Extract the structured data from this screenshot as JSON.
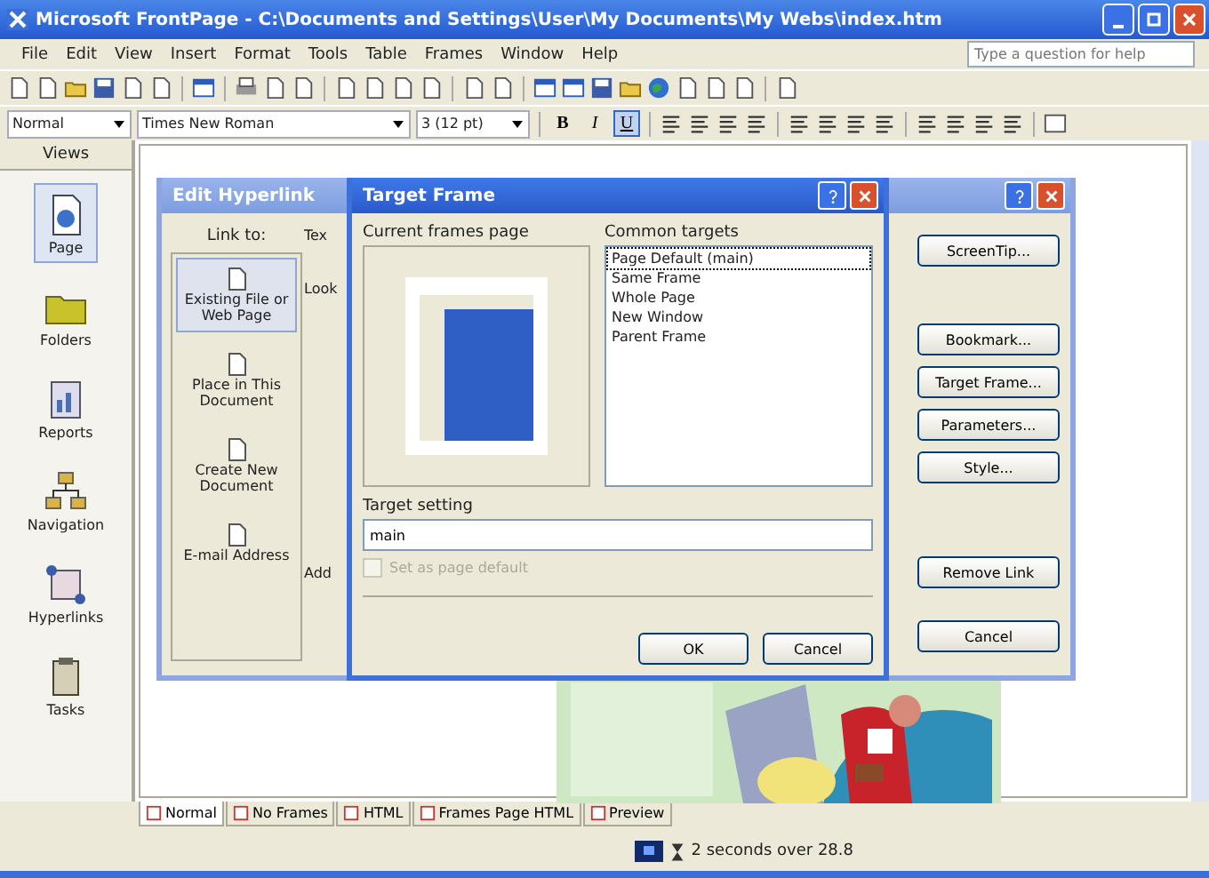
{
  "window": {
    "title": "Microsoft FrontPage - C:\\Documents and Settings\\User\\My Documents\\My Webs\\index.htm"
  },
  "menu": [
    "File",
    "Edit",
    "View",
    "Insert",
    "Format",
    "Tools",
    "Table",
    "Frames",
    "Window",
    "Help"
  ],
  "help_field": {
    "placeholder": "Type a question for help"
  },
  "formatting": {
    "style": "Normal",
    "font": "Times New Roman",
    "size": "3 (12 pt)",
    "buttons": [
      {
        "label": "B",
        "selected": false
      },
      {
        "label": "I",
        "selected": false
      },
      {
        "label": "U",
        "selected": true
      }
    ]
  },
  "views": {
    "title": "Views",
    "items": [
      {
        "label": "Page",
        "kind": "page",
        "selected": true
      },
      {
        "label": "Folders",
        "kind": "folders",
        "selected": false
      },
      {
        "label": "Reports",
        "kind": "reports",
        "selected": false
      },
      {
        "label": "Navigation",
        "kind": "navigation",
        "selected": false
      },
      {
        "label": "Hyperlinks",
        "kind": "hyperlinks",
        "selected": false
      },
      {
        "label": "Tasks",
        "kind": "tasks",
        "selected": false
      }
    ]
  },
  "edit_hyperlink": {
    "title": "Edit Hyperlink",
    "link_to_label": "Link to:",
    "link_to": [
      {
        "label": "Existing File or Web Page",
        "selected": true
      },
      {
        "label": "Place in This Document",
        "selected": false
      },
      {
        "label": "Create New Document",
        "selected": false
      },
      {
        "label": "E-mail Address",
        "selected": false
      }
    ],
    "partial_labels": [
      "Tex",
      "Look",
      "Add"
    ],
    "buttons": [
      "ScreenTip...",
      "Bookmark...",
      "Target Frame...",
      "Parameters...",
      "Style...",
      "Remove Link",
      "Cancel"
    ]
  },
  "target_frame": {
    "title": "Target Frame",
    "current_frames_label": "Current frames page",
    "common_targets_label": "Common targets",
    "common_targets": [
      {
        "label": "Page Default (main)",
        "selected": true
      },
      {
        "label": "Same Frame",
        "selected": false
      },
      {
        "label": "Whole Page",
        "selected": false
      },
      {
        "label": "New Window",
        "selected": false
      },
      {
        "label": "Parent Frame",
        "selected": false
      }
    ],
    "target_setting_label": "Target setting",
    "target_setting": "main",
    "page_default": {
      "label": "Set as page default",
      "checked": false,
      "disabled": true
    },
    "buttons": [
      "OK",
      "Cancel"
    ]
  },
  "page_tabs": [
    {
      "label": "Normal",
      "selected": true
    },
    {
      "label": "No Frames",
      "selected": false
    },
    {
      "label": "HTML",
      "selected": false
    },
    {
      "label": "Frames Page HTML",
      "selected": false
    },
    {
      "label": "Preview",
      "selected": false
    }
  ],
  "status_bar": {
    "download_time": "2 seconds over 28.8"
  }
}
